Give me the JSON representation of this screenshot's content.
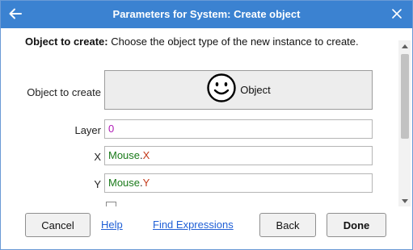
{
  "window": {
    "title": "Parameters for System: Create object",
    "back_icon": "arrow-left-icon",
    "close_icon": "close-icon"
  },
  "description": {
    "label": "Object to create:",
    "text": "Choose the object type of the new instance to create."
  },
  "params": {
    "object": {
      "label": "Object to create",
      "value": "Object",
      "icon": "smiley-face-icon"
    },
    "layer": {
      "label": "Layer",
      "value": "0"
    },
    "x": {
      "label": "X",
      "object": "Mouse",
      "dot": ".",
      "property": "X"
    },
    "y": {
      "label": "Y",
      "object": "Mouse",
      "dot": ".",
      "property": "Y"
    }
  },
  "footer": {
    "cancel": "Cancel",
    "help": "Help",
    "find_expressions": "Find Expressions",
    "back": "Back",
    "done": "Done"
  },
  "colors": {
    "titlebar": "#3b82d1",
    "number": "#b01ab6",
    "object_name": "#1a7a1a",
    "property": "#c43a1a",
    "link": "#1f5fd6"
  }
}
